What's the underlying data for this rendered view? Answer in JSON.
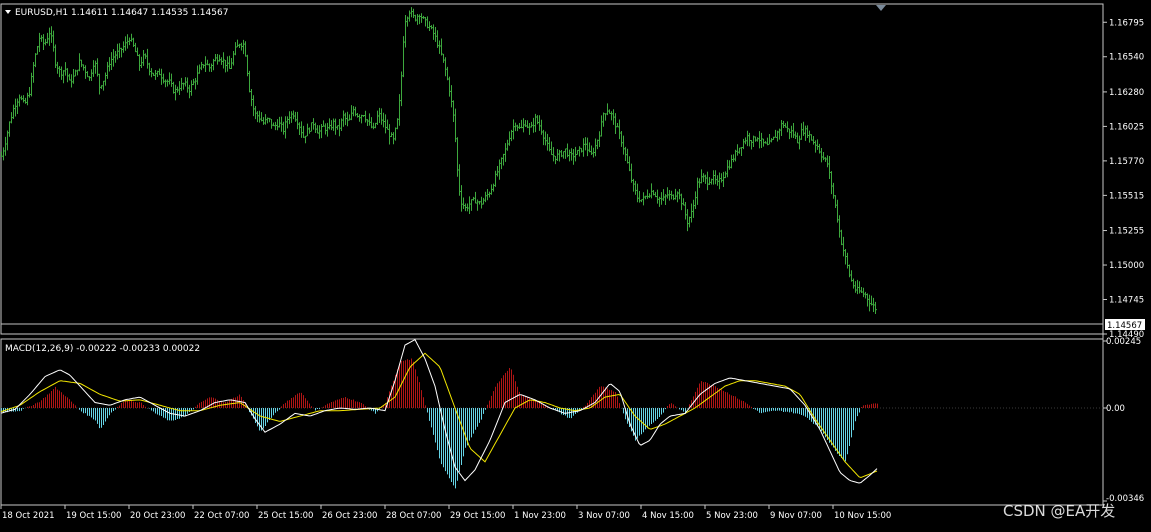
{
  "main": {
    "title": "EURUSD,H1  1.14611 1.14647 1.14535 1.14567",
    "price_ticks": [
      "1.16795",
      "1.16540",
      "1.16280",
      "1.16025",
      "1.15770",
      "1.15515",
      "1.15255",
      "1.15000",
      "1.14745",
      "1.14490"
    ],
    "current_price": "1.14567",
    "bar_color": "#3da83d"
  },
  "macd": {
    "title": "MACD(12,26,9) -0.00222 -0.00233 0.00022",
    "ticks": [
      "0.00245",
      "0.00",
      "-0.00346"
    ]
  },
  "time_axis": [
    "18 Oct 2021",
    "19 Oct 15:00",
    "20 Oct 23:00",
    "22 Oct 07:00",
    "25 Oct 15:00",
    "26 Oct 23:00",
    "28 Oct 07:00",
    "29 Oct 15:00",
    "1 Nov 23:00",
    "3 Nov 07:00",
    "4 Nov 15:00",
    "5 Nov 23:00",
    "9 Nov 07:00",
    "10 Nov 15:00"
  ],
  "watermark": "CSDN @EA开发",
  "chart_data": {
    "type": "line",
    "symbol": "EURUSD",
    "timeframe": "H1",
    "last_bar": {
      "open": 1.14611,
      "high": 1.14647,
      "low": 1.14535,
      "close": 1.14567
    },
    "y_range": [
      1.1449,
      1.1693
    ],
    "price_path_x": [
      0,
      4,
      9,
      14,
      19,
      24,
      29,
      34,
      39,
      44,
      49,
      52,
      55,
      60,
      65,
      69,
      74,
      79,
      84,
      89,
      94,
      99,
      104,
      109,
      114,
      119,
      124,
      129,
      134,
      139,
      144,
      149,
      154,
      159,
      164,
      169,
      174,
      179,
      184,
      189,
      194,
      199,
      204,
      209,
      214,
      219,
      224,
      229,
      234,
      239,
      244,
      249,
      254,
      258,
      263,
      268,
      273,
      278,
      283,
      288,
      293,
      298,
      303,
      308,
      313,
      318,
      323,
      328,
      333,
      338,
      343,
      348,
      353,
      358,
      363,
      368,
      373,
      378,
      383,
      388,
      393,
      398,
      401,
      404,
      409,
      414,
      419,
      424,
      429,
      434,
      439,
      444,
      449,
      454,
      457,
      460,
      465,
      470,
      475,
      480,
      485,
      490,
      495,
      500,
      505,
      510,
      515,
      520,
      525,
      530,
      535,
      540,
      545,
      550,
      555,
      560,
      565,
      570,
      575,
      580,
      585,
      590,
      595,
      600,
      603,
      607,
      612,
      617,
      622,
      627,
      632,
      637,
      642,
      647,
      652,
      657,
      662,
      667,
      672,
      677,
      682,
      687,
      692,
      697,
      702,
      707,
      712,
      717,
      722,
      727,
      732,
      737,
      742,
      747,
      752,
      757,
      762,
      767,
      772,
      777,
      782,
      787,
      792,
      797,
      802,
      807,
      812,
      817,
      822,
      827,
      832,
      836,
      840,
      845,
      850,
      855,
      860,
      865,
      870,
      875
    ],
    "price_path_y": [
      1.1578,
      1.1588,
      1.1605,
      1.1618,
      1.1625,
      1.1618,
      1.1628,
      1.1652,
      1.1668,
      1.1663,
      1.1672,
      1.1665,
      1.165,
      1.1642,
      1.1645,
      1.1635,
      1.164,
      1.165,
      1.1645,
      1.1638,
      1.1652,
      1.1632,
      1.1638,
      1.165,
      1.1655,
      1.1658,
      1.1662,
      1.1668,
      1.166,
      1.1648,
      1.1655,
      1.1645,
      1.164,
      1.1642,
      1.1637,
      1.1635,
      1.1628,
      1.1632,
      1.1634,
      1.163,
      1.1636,
      1.1644,
      1.165,
      1.1646,
      1.1652,
      1.1654,
      1.165,
      1.1645,
      1.1658,
      1.1664,
      1.1663,
      1.163,
      1.1612,
      1.161,
      1.1605,
      1.1608,
      1.1602,
      1.1605,
      1.16,
      1.161,
      1.1612,
      1.1605,
      1.1595,
      1.16,
      1.1605,
      1.1598,
      1.1602,
      1.16,
      1.1605,
      1.16,
      1.161,
      1.1605,
      1.1615,
      1.161,
      1.1612,
      1.1605,
      1.16,
      1.1612,
      1.1605,
      1.1598,
      1.1592,
      1.161,
      1.164,
      1.168,
      1.1688,
      1.1682,
      1.1686,
      1.168,
      1.1676,
      1.167,
      1.166,
      1.1648,
      1.163,
      1.1605,
      1.157,
      1.1548,
      1.1542,
      1.1546,
      1.1548,
      1.1545,
      1.155,
      1.1555,
      1.1565,
      1.1575,
      1.1585,
      1.1598,
      1.1605,
      1.16,
      1.1605,
      1.16,
      1.1608,
      1.1602,
      1.1592,
      1.1582,
      1.158,
      1.1582,
      1.1585,
      1.158,
      1.1582,
      1.1585,
      1.159,
      1.158,
      1.1588,
      1.16,
      1.1612,
      1.1615,
      1.161,
      1.16,
      1.159,
      1.1575,
      1.156,
      1.155,
      1.1548,
      1.1552,
      1.1555,
      1.155,
      1.1548,
      1.1552,
      1.155,
      1.1555,
      1.1545,
      1.1532,
      1.154,
      1.156,
      1.1565,
      1.1562,
      1.1565,
      1.156,
      1.1565,
      1.1572,
      1.1578,
      1.1585,
      1.159,
      1.1595,
      1.1592,
      1.1595,
      1.159,
      1.1588,
      1.1592,
      1.1598,
      1.1605,
      1.16,
      1.1598,
      1.1592,
      1.16,
      1.1598,
      1.1592,
      1.1588,
      1.158,
      1.1575,
      1.1555,
      1.154,
      1.152,
      1.1505,
      1.149,
      1.1482,
      1.148,
      1.1478,
      1.1472,
      1.1468,
      1.1462,
      1.1456
    ],
    "macd_range": [
      -0.00346,
      0.00245
    ],
    "macd_histogram_keys_x": [
      0,
      20,
      40,
      55,
      65,
      80,
      95,
      100,
      110,
      125,
      140,
      155,
      170,
      185,
      200,
      210,
      225,
      240,
      250,
      260,
      270,
      285,
      300,
      315,
      330,
      345,
      360,
      375,
      385,
      400,
      412,
      420,
      430,
      440,
      455,
      465,
      480,
      495,
      510,
      520,
      540,
      555,
      570,
      585,
      600,
      615,
      625,
      635,
      645,
      660,
      670,
      685,
      700,
      715,
      730,
      745,
      760,
      775,
      790,
      805,
      820,
      835,
      845,
      855,
      862,
      870,
      878
    ],
    "macd_histogram_keys": [
      -0.00015,
      -0.0001,
      0.00025,
      0.00075,
      0.00045,
      -0.0001,
      -0.00045,
      -0.0008,
      -0.0002,
      0.0003,
      0.0002,
      -0.0002,
      -0.0005,
      -0.0003,
      0.0002,
      0.0004,
      0.0002,
      0.0005,
      -0.0002,
      -0.0009,
      -0.0004,
      0.0002,
      0.0006,
      -0.0001,
      0.0002,
      0.0004,
      0.0002,
      -0.0002,
      0.0002,
      0.0017,
      0.0018,
      0.0008,
      -0.0006,
      -0.002,
      -0.003,
      -0.0015,
      -0.0005,
      0.0008,
      0.0015,
      0.0005,
      0.0002,
      -0.0001,
      -0.0004,
      0.0001,
      0.0008,
      0.0006,
      -0.0004,
      -0.0012,
      -0.0008,
      -0.0003,
      0.0002,
      -0.0002,
      0.001,
      0.0008,
      0.0005,
      0.0002,
      -0.0002,
      -0.0001,
      -0.00015,
      -0.0003,
      -0.0008,
      -0.0016,
      -0.002,
      -0.0005,
      0.0001,
      0.00015,
      0.00018
    ],
    "macd_line_x": [
      0,
      15,
      30,
      45,
      60,
      70,
      80,
      95,
      110,
      125,
      140,
      155,
      170,
      185,
      200,
      215,
      230,
      245,
      255,
      265,
      280,
      295,
      310,
      325,
      340,
      355,
      370,
      385,
      395,
      405,
      415,
      425,
      435,
      445,
      455,
      465,
      475,
      490,
      505,
      520,
      535,
      550,
      565,
      580,
      595,
      610,
      620,
      630,
      640,
      650,
      660,
      670,
      685,
      700,
      715,
      730,
      745,
      760,
      775,
      790,
      805,
      820,
      830,
      840,
      850,
      860,
      870,
      878
    ],
    "macd_line": [
      -0.0002,
      -5e-05,
      0.0005,
      0.00115,
      0.0014,
      0.0012,
      0.0008,
      0.0002,
      0.0001,
      0.0003,
      0.0004,
      0.0001,
      -0.0002,
      -0.0003,
      -0.0001,
      0.0002,
      0.0003,
      0.0002,
      -0.0004,
      -0.0009,
      -0.0006,
      -0.0002,
      -0.0003,
      -0.0001,
      0.0,
      -5e-05,
      0.0,
      -0.0001,
      0.001,
      0.0023,
      0.0025,
      0.0018,
      0.0008,
      -0.0008,
      -0.0022,
      -0.0027,
      -0.0023,
      -0.0012,
      0.0002,
      0.0005,
      0.0003,
      0.0,
      -0.0002,
      -0.0001,
      0.0002,
      0.0009,
      0.0006,
      -0.0006,
      -0.0014,
      -0.0012,
      -0.0006,
      -0.0003,
      -0.0002,
      0.0005,
      0.0009,
      0.0011,
      0.001,
      0.0009,
      0.0008,
      0.0007,
      0.0001,
      -0.0008,
      -0.0016,
      -0.0024,
      -0.0027,
      -0.0028,
      -0.0025,
      -0.00222
    ],
    "signal_line_x": [
      0,
      20,
      40,
      60,
      80,
      100,
      120,
      140,
      160,
      180,
      200,
      220,
      240,
      260,
      280,
      300,
      320,
      340,
      360,
      380,
      395,
      410,
      425,
      440,
      455,
      470,
      485,
      500,
      515,
      530,
      545,
      560,
      575,
      590,
      605,
      620,
      635,
      650,
      665,
      680,
      695,
      710,
      725,
      740,
      755,
      770,
      785,
      800,
      815,
      830,
      845,
      860,
      878
    ],
    "signal_line": [
      -0.00015,
      0.0001,
      0.0006,
      0.001,
      0.0009,
      0.0005,
      0.00025,
      0.0003,
      0.0001,
      -0.0001,
      -0.0001,
      0.0001,
      0.0002,
      -0.0003,
      -0.0005,
      -0.0003,
      -0.0001,
      -0.0001,
      -5e-05,
      0.0,
      0.0004,
      0.0015,
      0.002,
      0.0015,
      0.0,
      -0.0015,
      -0.002,
      -0.001,
      0.0,
      0.0003,
      0.0002,
      0.0,
      -0.0001,
      0.0,
      0.0004,
      0.0005,
      -0.0003,
      -0.0008,
      -0.0006,
      -0.0003,
      0.0,
      0.0004,
      0.0008,
      0.001,
      0.001,
      0.0009,
      0.0008,
      0.0005,
      -0.0004,
      -0.0012,
      -0.002,
      -0.0026,
      -0.00233
    ]
  }
}
